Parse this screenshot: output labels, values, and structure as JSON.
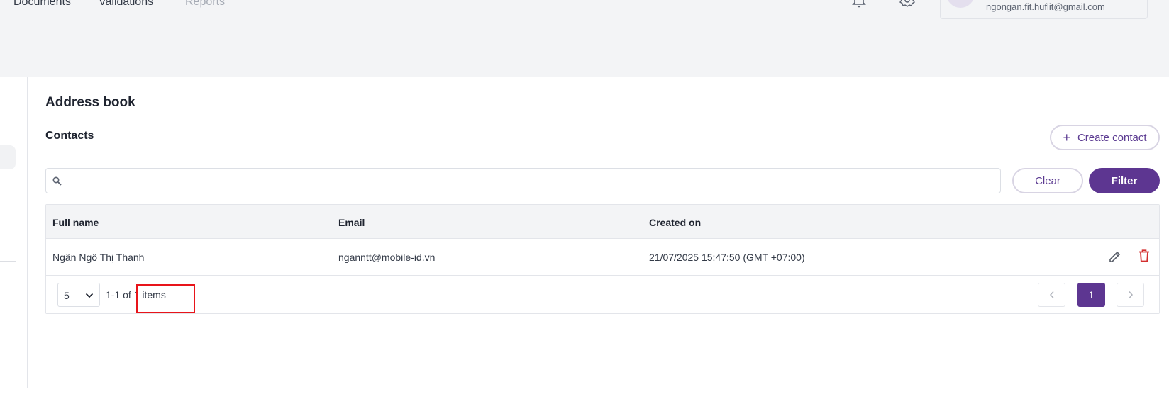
{
  "nav": {
    "documents": "Documents",
    "validations": "Validations",
    "reports": "Reports"
  },
  "header": {
    "notification_icon": "bell-icon",
    "settings_icon": "gear-icon",
    "user_email": "ngongan.fit.huflit@gmail.com"
  },
  "page": {
    "title": "Address book",
    "section_title": "Contacts",
    "create_label": "Create contact"
  },
  "search": {
    "value": "",
    "placeholder": ""
  },
  "filters": {
    "clear_label": "Clear",
    "filter_label": "Filter"
  },
  "table": {
    "columns": [
      "Full name",
      "Email",
      "Created on"
    ],
    "rows": [
      {
        "full_name": "Ngân Ngô Thị Thanh",
        "email": "nganntt@mobile-id.vn",
        "created_on": "21/07/2025 15:47:50 (GMT +07:00)"
      }
    ]
  },
  "pagination": {
    "page_size": "5",
    "range_text": "1-1 of 1 items",
    "current_page": "1"
  },
  "colors": {
    "accent": "#5d3691",
    "delete": "#d32f2f",
    "highlight": "#e8141a"
  }
}
